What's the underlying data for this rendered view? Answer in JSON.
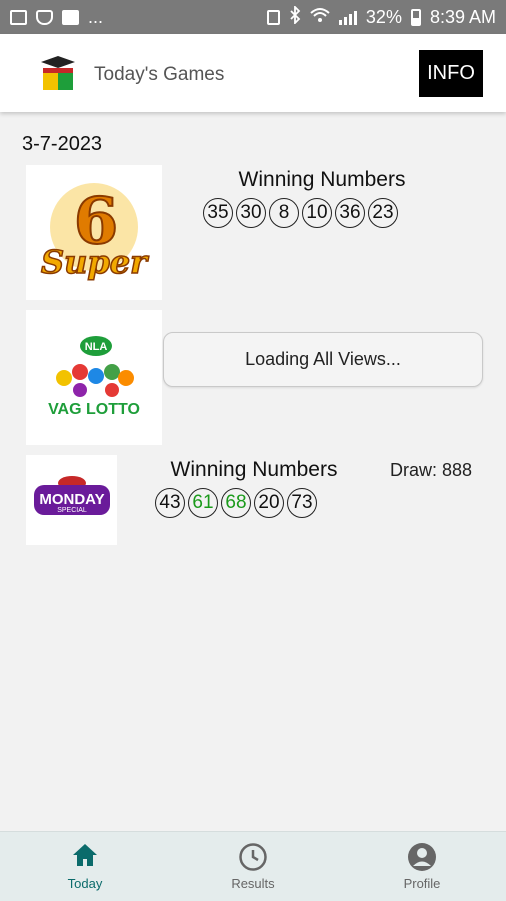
{
  "status_bar": {
    "left_text": "...",
    "battery": "32%",
    "time": "8:39 AM"
  },
  "header": {
    "title": "Today's Games",
    "info_button": "INFO"
  },
  "date": "3-7-2023",
  "games": [
    {
      "logo_text": "Super 6",
      "logo_number": "6",
      "logo_word": "Super",
      "title": "Winning Numbers",
      "numbers": [
        "35",
        "30",
        "8",
        "10",
        "36",
        "23"
      ]
    },
    {
      "logo_top": "NLA",
      "logo_text": "VAG LOTTO",
      "loading_text": "Loading All Views..."
    },
    {
      "logo_text": "MONDAY",
      "logo_sub": "SPECIAL",
      "title": "Winning Numbers",
      "draw": "Draw: 888",
      "numbers": [
        "43",
        "61",
        "68",
        "20",
        "73"
      ],
      "highlighted": [
        "61",
        "68"
      ]
    }
  ],
  "bottom_nav": [
    {
      "label": "Today",
      "icon": "home-icon",
      "active": true
    },
    {
      "label": "Results",
      "icon": "clock-icon",
      "active": false
    },
    {
      "label": "Profile",
      "icon": "profile-icon",
      "active": false
    }
  ],
  "colors": {
    "accent": "#0b6b6b",
    "hit": "#1a9a1a",
    "background": "#f2f2f2",
    "nav_background": "#e4ecec"
  }
}
